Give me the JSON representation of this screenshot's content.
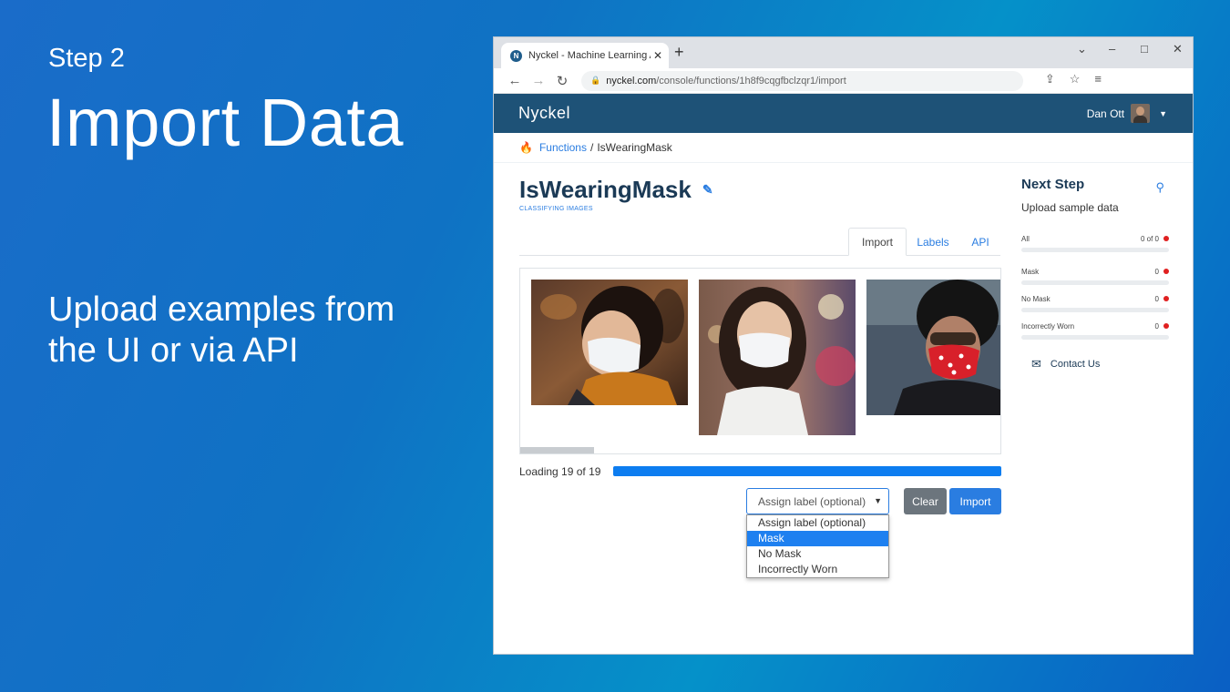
{
  "slide": {
    "step": "Step 2",
    "title": "Import Data",
    "body": "Upload examples from the UI or via API"
  },
  "browser": {
    "tab_title": "Nyckel - Machine Learning API -",
    "tab_close": "✕",
    "new_tab": "+",
    "url_host": "nyckel.com",
    "url_path": "/console/functions/1h8f9cqgfbclzqr1/import"
  },
  "app": {
    "brand": "Nyckel",
    "user_name": "Dan Ott",
    "breadcrumb": {
      "root": "Functions",
      "separator": "/",
      "current": "IsWearingMask"
    },
    "function_title": "IsWearingMask",
    "function_subtitle": "CLASSIFYING IMAGES",
    "tabs": [
      {
        "label": "Import",
        "active": true
      },
      {
        "label": "Labels",
        "active": false
      },
      {
        "label": "API",
        "active": false
      }
    ],
    "photos": [
      "woman-profile-mask-photo",
      "woman-white-mask-photo",
      "woman-red-mask-photo"
    ],
    "loading_text": "Loading 19 of 19",
    "progress": 1.0,
    "select": {
      "value": "Assign label (optional)"
    },
    "dropdown_options": [
      {
        "label": "Assign label (optional)",
        "selected": false
      },
      {
        "label": "Mask",
        "selected": true
      },
      {
        "label": "No Mask",
        "selected": false
      },
      {
        "label": "Incorrectly Worn",
        "selected": false
      }
    ],
    "buttons": {
      "clear": "Clear",
      "import": "Import"
    },
    "next_step": {
      "title": "Next Step",
      "subtitle": "Upload sample data",
      "stats": [
        {
          "label": "All",
          "value": "0 of 0"
        },
        {
          "label": "Mask",
          "value": "0"
        },
        {
          "label": "No Mask",
          "value": "0"
        },
        {
          "label": "Incorrectly Worn",
          "value": "0"
        }
      ],
      "contact": "Contact Us"
    }
  },
  "colors": {
    "appbar": "#1e5277",
    "accent": "#2a7de1",
    "progress": "#0d7df0",
    "alert": "#e02020"
  }
}
